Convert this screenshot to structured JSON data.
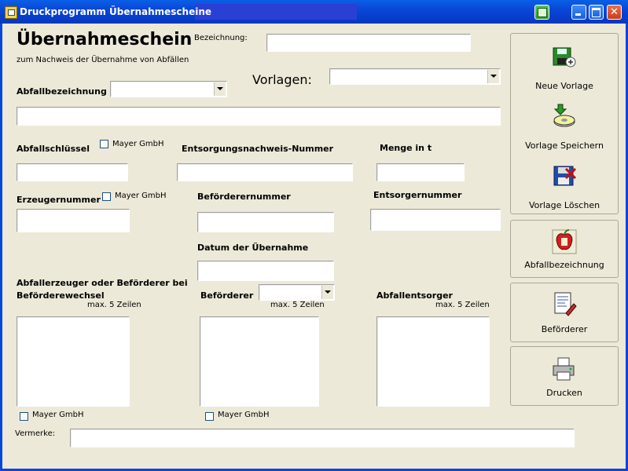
{
  "window": {
    "title": "Druckprogramm Übernahmescheine"
  },
  "form": {
    "heading": "Übernahmeschein",
    "subheading": "zum Nachweis der Übernahme von Abfällen",
    "bezeichnung_label": "Bezeichnung:",
    "vorlagen_label": "Vorlagen:",
    "abfallbezeichnung_label": "Abfallbezeichnung",
    "abfallschluessel_label": "Abfallschlüssel",
    "entsorgungsnachweis_label": "Entsorgungsnachweis-Nummer",
    "menge_label": "Menge in t",
    "erzeugernummer_label": "Erzeugernummer",
    "befoerderernummer_label": "Beförderernummer",
    "entsorgernummer_label": "Entsorgernummer",
    "datum_label": "Datum der Übernahme",
    "abfallerzeuger_label_1": "Abfallerzeuger oder Beförderer bei",
    "abfallerzeuger_label_2": "Beförderewechsel",
    "befoerderer_label": "Beförderer",
    "abfallentsorger_label": "Abfallentsorger",
    "max_zeilen": "max. 5 Zeilen",
    "mayer_gmbh": "Mayer GmbH",
    "vermerke_label": "Vermerke:"
  },
  "sidebar": {
    "neue_vorlage": "Neue Vorlage",
    "vorlage_speichern": "Vorlage Speichern",
    "vorlage_loeschen": "Vorlage Löschen",
    "abfallbezeichnung": "Abfallbezeichnung",
    "befoerderer": "Beförderer",
    "drucken": "Drucken"
  },
  "colors": {
    "titlebar": "#0a46d8",
    "face": "#ece9d8"
  }
}
